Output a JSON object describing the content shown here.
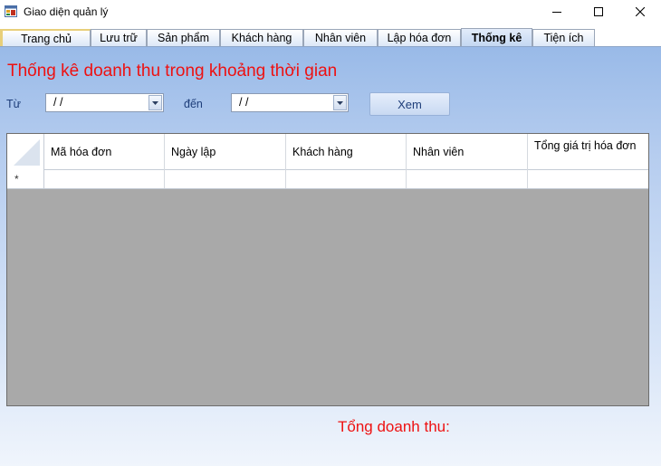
{
  "window": {
    "title": "Giao diện quản lý",
    "controls": [
      "minimize",
      "maximize",
      "close"
    ]
  },
  "tabs": [
    {
      "label": "Trang chủ",
      "active": false
    },
    {
      "label": "Lưu trữ",
      "active": false
    },
    {
      "label": "Sản phẩm",
      "active": false
    },
    {
      "label": "Khách hàng",
      "active": false
    },
    {
      "label": "Nhân viên",
      "active": false
    },
    {
      "label": "Lập hóa đơn",
      "active": false
    },
    {
      "label": "Thống kê",
      "active": true
    },
    {
      "label": "Tiện ích",
      "active": false
    }
  ],
  "main": {
    "heading": "Thống kê doanh thu trong khoảng thời gian",
    "from_label": "Từ",
    "from_value": " /  /",
    "to_label": "đến",
    "to_value": " /  /",
    "view_button": "Xem",
    "total_label": "Tổng doanh thu:"
  },
  "grid": {
    "columns": [
      "Mã hóa đơn",
      "Ngày lập",
      "Khách hàng",
      "Nhân viên",
      "Tổng giá trị hóa đơn"
    ],
    "new_row_marker": "*",
    "rows": []
  },
  "colors": {
    "accent_red": "#ee1111",
    "label_blue": "#1e3e7a",
    "grid_empty": "#a9a9a9"
  }
}
